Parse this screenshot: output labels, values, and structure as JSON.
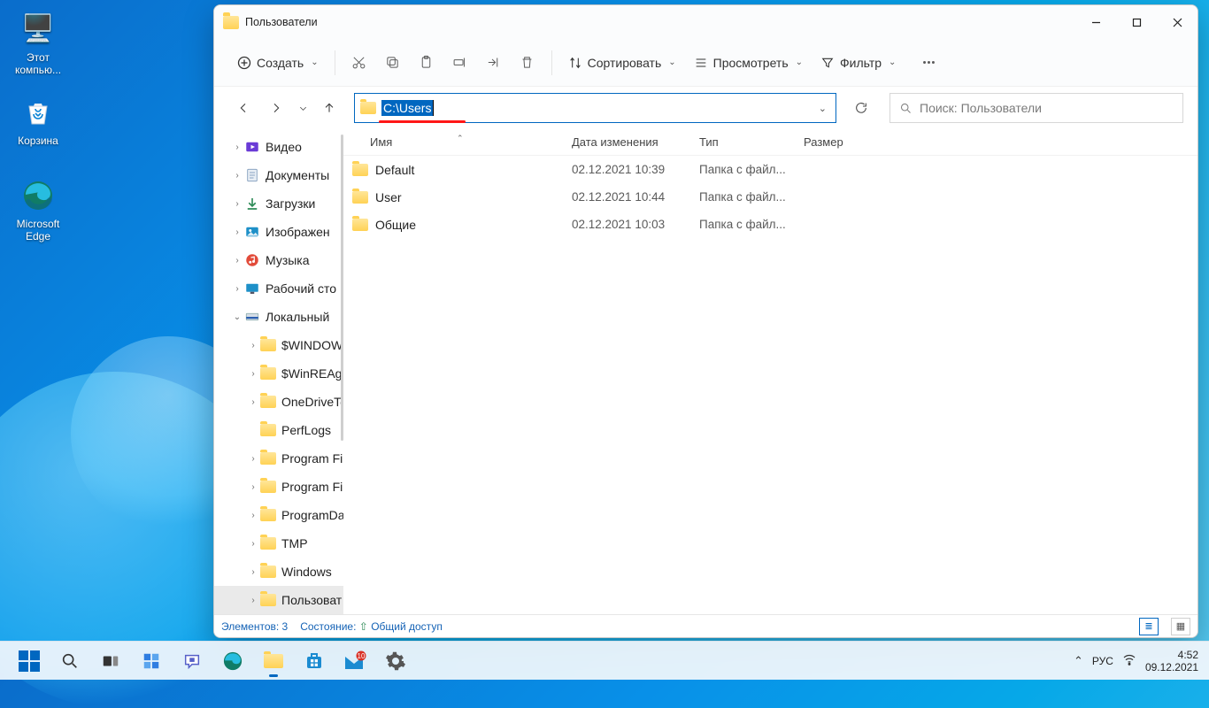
{
  "desktop": {
    "icons": [
      {
        "label": "Этот\nкомпью...",
        "glyph": "🖥️"
      },
      {
        "label": "Корзина",
        "glyph": "🗑️"
      },
      {
        "label": "Microsoft\nEdge",
        "glyph": "🌐"
      }
    ]
  },
  "window": {
    "title": "Пользователи",
    "toolbar": {
      "new": "Создать",
      "sort": "Сортировать",
      "view": "Просмотреть",
      "filter": "Фильтр"
    },
    "address": "C:\\Users",
    "search_placeholder": "Поиск: Пользователи",
    "tree": [
      {
        "indent": 18,
        "exp": ">",
        "icon": "video",
        "label": "Видео",
        "color": "#6a3bd6"
      },
      {
        "indent": 18,
        "exp": ">",
        "icon": "doc",
        "label": "Документы",
        "color": "#2f6fb3"
      },
      {
        "indent": 18,
        "exp": ">",
        "icon": "down",
        "label": "Загрузки",
        "color": "#2e8b57"
      },
      {
        "indent": 18,
        "exp": ">",
        "icon": "img",
        "label": "Изображен",
        "color": "#1e90c8"
      },
      {
        "indent": 18,
        "exp": ">",
        "icon": "music",
        "label": "Музыка",
        "color": "#e24b3a"
      },
      {
        "indent": 18,
        "exp": ">",
        "icon": "desk",
        "label": "Рабочий сто",
        "color": "#1e90c8"
      },
      {
        "indent": 18,
        "exp": "v",
        "icon": "disk",
        "label": "Локальный",
        "color": "#2a5fb0"
      },
      {
        "indent": 36,
        "exp": ">",
        "icon": "fold",
        "label": "$WINDOW"
      },
      {
        "indent": 36,
        "exp": ">",
        "icon": "fold",
        "label": "$WinREAg"
      },
      {
        "indent": 36,
        "exp": ">",
        "icon": "fold",
        "label": "OneDriveTe"
      },
      {
        "indent": 36,
        "exp": "",
        "icon": "fold",
        "label": "PerfLogs"
      },
      {
        "indent": 36,
        "exp": ">",
        "icon": "fold",
        "label": "Program Fi"
      },
      {
        "indent": 36,
        "exp": ">",
        "icon": "fold",
        "label": "Program Fi"
      },
      {
        "indent": 36,
        "exp": ">",
        "icon": "fold",
        "label": "ProgramDa"
      },
      {
        "indent": 36,
        "exp": ">",
        "icon": "fold",
        "label": "TMP"
      },
      {
        "indent": 36,
        "exp": ">",
        "icon": "fold",
        "label": "Windows"
      },
      {
        "indent": 36,
        "exp": ">",
        "icon": "fold",
        "label": "Пользоват",
        "sel": true
      }
    ],
    "columns": {
      "name": "Имя",
      "date": "Дата изменения",
      "type": "Тип",
      "size": "Размер"
    },
    "rows": [
      {
        "name": "Default",
        "date": "02.12.2021 10:39",
        "type": "Папка с файл..."
      },
      {
        "name": "User",
        "date": "02.12.2021 10:44",
        "type": "Папка с файл..."
      },
      {
        "name": "Общие",
        "date": "02.12.2021 10:03",
        "type": "Папка с файл..."
      }
    ],
    "status": {
      "count": "Элементов: 3",
      "state_label": "Состояние:",
      "state_value": "Общий доступ"
    }
  },
  "taskbar": {
    "lang": "РУС",
    "time": "4:52",
    "date": "09.12.2021"
  }
}
